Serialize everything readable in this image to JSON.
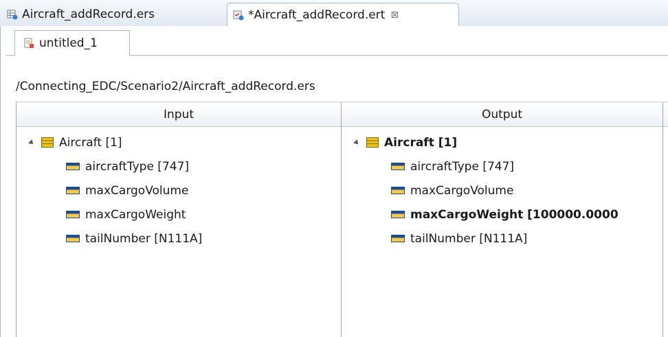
{
  "editor_tabs": [
    {
      "label": "Aircraft_addRecord.ers",
      "active": false
    },
    {
      "label": "*Aircraft_addRecord.ert",
      "active": true,
      "close_glyph": "⊠"
    }
  ],
  "sheet_tab": {
    "label": "untitled_1"
  },
  "path": "/Connecting_EDC/Scenario2/Aircraft_addRecord.ers",
  "columns": {
    "input": "Input",
    "output": "Output"
  },
  "input_tree": {
    "root": "Aircraft [1]",
    "children": [
      "aircraftType [747]",
      "maxCargoVolume",
      "maxCargoWeight",
      "tailNumber [N111A]"
    ]
  },
  "output_tree": {
    "root": "Aircraft [1]",
    "children": [
      "aircraftType [747]",
      "maxCargoVolume",
      "maxCargoWeight [100000.0000",
      "tailNumber [N111A]"
    ]
  },
  "colors": {
    "entity_icon": "#f0c419",
    "attr_icon": "#f2c94c",
    "attr_icon_band": "#1f4e8c"
  }
}
